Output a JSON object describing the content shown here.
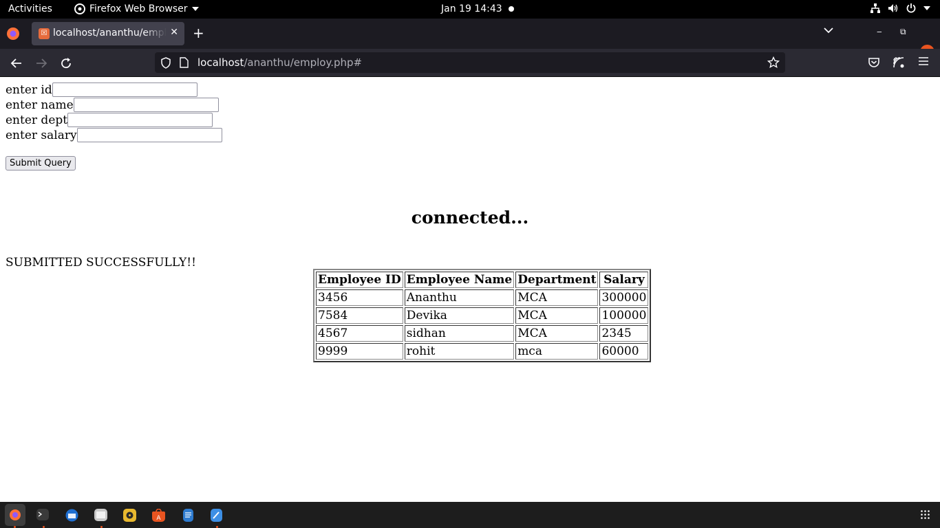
{
  "topbar": {
    "activities": "Activities",
    "app_menu": "Firefox Web Browser",
    "clock": "Jan 19  14:43"
  },
  "browser": {
    "tab_title": "localhost/ananthu/employ.php#",
    "url_host": "localhost",
    "url_path": "/ananthu/employ.php#"
  },
  "form": {
    "id_label": "enter id",
    "name_label": "enter name",
    "dept_label": "enter dept",
    "salary_label": "enter salary",
    "id_value": "",
    "name_value": "",
    "dept_value": "",
    "salary_value": "",
    "submit_label": "Submit Query"
  },
  "status": {
    "connected": "connected...",
    "submitted": "SUBMITTED SUCCESSFULLY!!"
  },
  "table": {
    "headers": [
      "Employee ID",
      "Employee Name",
      "Department",
      "Salary"
    ],
    "rows": [
      [
        "3456",
        "Ananthu",
        "MCA",
        "300000"
      ],
      [
        "7584",
        "Devika",
        "MCA",
        "100000"
      ],
      [
        "4567",
        "sidhan",
        "MCA",
        "2345"
      ],
      [
        "9999",
        "rohit",
        "mca",
        "60000"
      ]
    ]
  },
  "dock": {
    "apps": [
      "firefox-icon",
      "terminal-icon",
      "thunderbird-icon",
      "files-icon",
      "rhythmbox-icon",
      "software-center-icon",
      "writer-icon",
      "text-editor-icon"
    ]
  }
}
